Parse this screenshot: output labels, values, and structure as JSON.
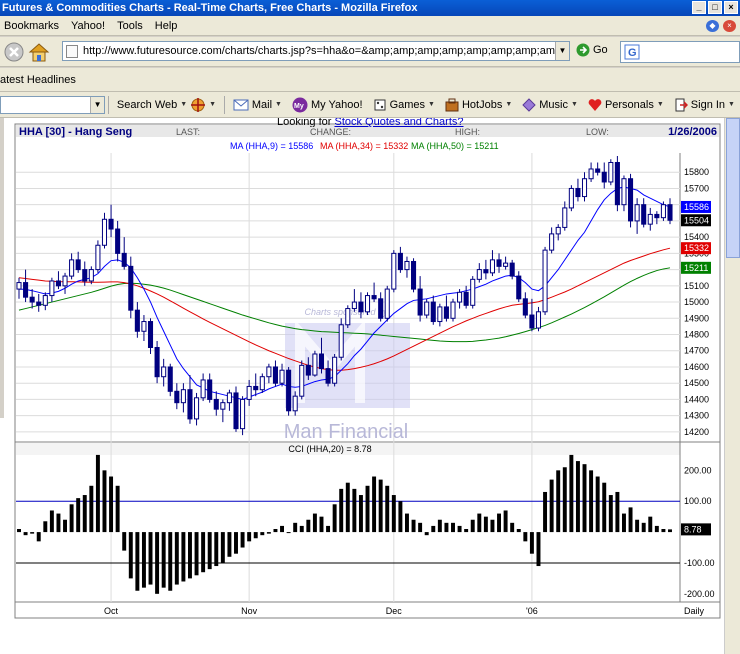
{
  "window": {
    "title": "Futures & Commodities Charts - Real-Time Charts, Free Charts - Mozilla Firefox"
  },
  "menu": {
    "items": [
      "Bookmarks",
      "Yahoo!",
      "Tools",
      "Help"
    ]
  },
  "nav": {
    "url": "http://www.futuresource.com/charts/charts.jsp?s=hha&o=&amp;amp;amp;amp;amp;amp;amp;amp;amp;a=D",
    "go_label": "Go"
  },
  "bookmarks": {
    "latest_headlines": "atest Headlines"
  },
  "yahoo_toolbar": {
    "search_web": "Search Web",
    "mail": "Mail",
    "my_yahoo": "My Yahoo!",
    "games": "Games",
    "hotjobs": "HotJobs",
    "music": "Music",
    "personals": "Personals",
    "sign_in": "Sign In"
  },
  "page": {
    "link_prefix": "Looking for ",
    "link_text": "Stock Quotes and Charts?"
  },
  "chart_header": {
    "symbol": "HHA [30] - Hang Seng",
    "last_label": "LAST:",
    "change_label": "CHANGE:",
    "high_label": "HIGH:",
    "low_label": "LOW:",
    "date": "1/26/2006"
  },
  "ma_legend": {
    "ma9": "MA (HHA,9) = 15586",
    "ma34": "MA (HHA,34) = 15332",
    "ma50": "MA (HHA,50) = 15211"
  },
  "watermark": {
    "sponsor": "Charts sponsored by",
    "brand": "Man Financial"
  },
  "cci_legend": "CCI (HHA,20) = 8.78",
  "colors": {
    "ma9": "#0000ff",
    "ma34": "#e00000",
    "ma50": "#008000",
    "candle": "#000080",
    "cci": "#000000"
  },
  "chart_data": {
    "type": "candlestick",
    "title": "HHA [30] - Hang Seng",
    "price_axis": {
      "ticks": [
        14200,
        14300,
        14400,
        14500,
        14600,
        14700,
        14800,
        14900,
        15000,
        15100,
        15200,
        15300,
        15400,
        15500,
        15600,
        15700,
        15800
      ],
      "ylim": [
        14150,
        15900
      ]
    },
    "price_badges": [
      {
        "label": "15586",
        "value": 15586,
        "bg": "#0000ff"
      },
      {
        "label": "15504",
        "value": 15504,
        "bg": "#000000"
      },
      {
        "label": "15332",
        "value": 15332,
        "bg": "#e00000"
      },
      {
        "label": "15211",
        "value": 15211,
        "bg": "#008000"
      }
    ],
    "x_labels": [
      {
        "label": "Oct",
        "index": 14
      },
      {
        "label": "Nov",
        "index": 35
      },
      {
        "label": "Dec",
        "index": 57
      },
      {
        "label": "'06",
        "index": 78
      },
      {
        "label": "Daily",
        "index": 97
      }
    ],
    "candles": [
      [
        15080,
        15150,
        15020,
        15120
      ],
      [
        15120,
        15200,
        15000,
        15030
      ],
      [
        15030,
        15080,
        14960,
        15000
      ],
      [
        15000,
        15050,
        14940,
        14980
      ],
      [
        14980,
        15060,
        14950,
        15040
      ],
      [
        15040,
        15150,
        15000,
        15130
      ],
      [
        15130,
        15190,
        15080,
        15100
      ],
      [
        15100,
        15180,
        15050,
        15160
      ],
      [
        15160,
        15300,
        15140,
        15260
      ],
      [
        15260,
        15310,
        15180,
        15200
      ],
      [
        15200,
        15250,
        15100,
        15130
      ],
      [
        15130,
        15220,
        15110,
        15200
      ],
      [
        15200,
        15380,
        15180,
        15350
      ],
      [
        15350,
        15550,
        15330,
        15510
      ],
      [
        15510,
        15600,
        15400,
        15450
      ],
      [
        15450,
        15500,
        15250,
        15300
      ],
      [
        15300,
        15400,
        15200,
        15220
      ],
      [
        15220,
        15280,
        14900,
        14950
      ],
      [
        14950,
        15000,
        14780,
        14820
      ],
      [
        14820,
        14920,
        14760,
        14880
      ],
      [
        14880,
        14900,
        14680,
        14720
      ],
      [
        14720,
        14760,
        14500,
        14540
      ],
      [
        14540,
        14650,
        14480,
        14600
      ],
      [
        14600,
        14620,
        14420,
        14450
      ],
      [
        14450,
        14500,
        14340,
        14380
      ],
      [
        14380,
        14500,
        14320,
        14460
      ],
      [
        14460,
        14550,
        14250,
        14280
      ],
      [
        14280,
        14440,
        14240,
        14410
      ],
      [
        14410,
        14560,
        14390,
        14520
      ],
      [
        14520,
        14560,
        14380,
        14400
      ],
      [
        14400,
        14450,
        14300,
        14340
      ],
      [
        14340,
        14400,
        14260,
        14380
      ],
      [
        14380,
        14460,
        14330,
        14440
      ],
      [
        14440,
        14480,
        14200,
        14220
      ],
      [
        14220,
        14420,
        14180,
        14400
      ],
      [
        14400,
        14520,
        14360,
        14480
      ],
      [
        14480,
        14560,
        14420,
        14460
      ],
      [
        14460,
        14560,
        14440,
        14540
      ],
      [
        14540,
        14620,
        14500,
        14600
      ],
      [
        14600,
        14640,
        14480,
        14500
      ],
      [
        14500,
        14620,
        14480,
        14580
      ],
      [
        14580,
        14600,
        14300,
        14330
      ],
      [
        14330,
        14450,
        14300,
        14420
      ],
      [
        14420,
        14640,
        14400,
        14610
      ],
      [
        14610,
        14660,
        14520,
        14550
      ],
      [
        14550,
        14700,
        14540,
        14680
      ],
      [
        14680,
        14780,
        14560,
        14590
      ],
      [
        14590,
        14640,
        14480,
        14500
      ],
      [
        14500,
        14680,
        14480,
        14660
      ],
      [
        14660,
        14900,
        14640,
        14860
      ],
      [
        14860,
        14980,
        14840,
        14960
      ],
      [
        14960,
        15080,
        14940,
        15000
      ],
      [
        15000,
        15060,
        14900,
        14940
      ],
      [
        14940,
        15060,
        14920,
        15040
      ],
      [
        15040,
        15120,
        15000,
        15020
      ],
      [
        15020,
        15060,
        14880,
        14900
      ],
      [
        14900,
        15100,
        14880,
        15080
      ],
      [
        15080,
        15320,
        15060,
        15300
      ],
      [
        15300,
        15340,
        15180,
        15200
      ],
      [
        15200,
        15280,
        15150,
        15250
      ],
      [
        15250,
        15270,
        15060,
        15080
      ],
      [
        15080,
        15160,
        14880,
        14920
      ],
      [
        14920,
        15020,
        14900,
        15000
      ],
      [
        15000,
        15040,
        14860,
        14880
      ],
      [
        14880,
        14990,
        14850,
        14970
      ],
      [
        14970,
        15040,
        14880,
        14900
      ],
      [
        14900,
        15020,
        14880,
        15000
      ],
      [
        15000,
        15080,
        14960,
        15060
      ],
      [
        15060,
        15100,
        14960,
        14980
      ],
      [
        14980,
        15160,
        14960,
        15140
      ],
      [
        15140,
        15240,
        15120,
        15200
      ],
      [
        15200,
        15260,
        15140,
        15180
      ],
      [
        15180,
        15320,
        15160,
        15260
      ],
      [
        15260,
        15300,
        15180,
        15220
      ],
      [
        15220,
        15280,
        15200,
        15240
      ],
      [
        15240,
        15260,
        15140,
        15160
      ],
      [
        15160,
        15190,
        15000,
        15020
      ],
      [
        15020,
        15060,
        14900,
        14920
      ],
      [
        14920,
        15020,
        14820,
        14840
      ],
      [
        14840,
        14970,
        14820,
        14940
      ],
      [
        14940,
        15340,
        14920,
        15320
      ],
      [
        15320,
        15460,
        15300,
        15420
      ],
      [
        15420,
        15480,
        15380,
        15460
      ],
      [
        15460,
        15620,
        15440,
        15580
      ],
      [
        15580,
        15720,
        15560,
        15700
      ],
      [
        15700,
        15760,
        15620,
        15650
      ],
      [
        15650,
        15800,
        15620,
        15760
      ],
      [
        15760,
        15860,
        15740,
        15820
      ],
      [
        15820,
        15860,
        15780,
        15800
      ],
      [
        15800,
        15860,
        15700,
        15740
      ],
      [
        15740,
        15880,
        15720,
        15860
      ],
      [
        15860,
        15900,
        15560,
        15600
      ],
      [
        15600,
        15780,
        15560,
        15760
      ],
      [
        15760,
        15790,
        15460,
        15500
      ],
      [
        15500,
        15640,
        15420,
        15600
      ],
      [
        15600,
        15640,
        15460,
        15480
      ],
      [
        15480,
        15580,
        15440,
        15540
      ],
      [
        15540,
        15560,
        15480,
        15520
      ],
      [
        15520,
        15620,
        15500,
        15600
      ],
      [
        15600,
        15640,
        15480,
        15504
      ]
    ],
    "ma9": [
      15080,
      15078,
      15070,
      15060,
      15050,
      15056,
      15066,
      15085,
      15110,
      15130,
      15140,
      15150,
      15175,
      15220,
      15255,
      15260,
      15245,
      15210,
      15150,
      15080,
      15000,
      14905,
      14820,
      14735,
      14650,
      14590,
      14540,
      14490,
      14470,
      14450,
      14440,
      14430,
      14420,
      14410,
      14400,
      14415,
      14430,
      14445,
      14465,
      14480,
      14495,
      14480,
      14475,
      14480,
      14495,
      14510,
      14520,
      14525,
      14540,
      14580,
      14620,
      14670,
      14710,
      14760,
      14810,
      14850,
      14890,
      14930,
      14960,
      14990,
      15010,
      15015,
      15020,
      15030,
      15040,
      15050,
      15055,
      15060,
      15070,
      15080,
      15095,
      15110,
      15130,
      15145,
      15160,
      15165,
      15150,
      15120,
      15080,
      15070,
      15100,
      15150,
      15200,
      15260,
      15320,
      15380,
      15430,
      15500,
      15570,
      15630,
      15670,
      15700,
      15710,
      15700,
      15690,
      15660,
      15640,
      15620,
      15600,
      15586
    ],
    "ma34": [
      15150,
      15145,
      15140,
      15135,
      15130,
      15128,
      15126,
      15125,
      15125,
      15124,
      15123,
      15122,
      15122,
      15123,
      15124,
      15124,
      15120,
      15112,
      15100,
      15085,
      15068,
      15050,
      15030,
      15008,
      14985,
      14962,
      14940,
      14918,
      14896,
      14875,
      14855,
      14835,
      14815,
      14795,
      14775,
      14755,
      14736,
      14718,
      14700,
      14684,
      14668,
      14652,
      14638,
      14624,
      14610,
      14600,
      14590,
      14584,
      14580,
      14580,
      14584,
      14590,
      14598,
      14608,
      14620,
      14634,
      14650,
      14668,
      14688,
      14708,
      14728,
      14748,
      14768,
      14788,
      14808,
      14828,
      14848,
      14866,
      14884,
      14900,
      14916,
      14930,
      14944,
      14958,
      14970,
      14980,
      14986,
      14990,
      14995,
      15002,
      15015,
      15030,
      15046,
      15062,
      15080,
      15100,
      15120,
      15140,
      15160,
      15180,
      15200,
      15220,
      15240,
      15256,
      15270,
      15284,
      15298,
      15310,
      15322,
      15332
    ],
    "ma50": [
      14950,
      14960,
      14970,
      14980,
      14990,
      15000,
      15010,
      15020,
      15030,
      15040,
      15050,
      15060,
      15072,
      15085,
      15098,
      15108,
      15114,
      15116,
      15114,
      15110,
      15104,
      15096,
      15086,
      15074,
      15060,
      15046,
      15032,
      15018,
      15004,
      14990,
      14976,
      14962,
      14948,
      14934,
      14920,
      14908,
      14896,
      14884,
      14872,
      14862,
      14852,
      14844,
      14836,
      14830,
      14826,
      14822,
      14818,
      14816,
      14814,
      14812,
      14810,
      14808,
      14806,
      14804,
      14800,
      14796,
      14792,
      14788,
      14784,
      14780,
      14776,
      14772,
      14768,
      14764,
      14760,
      14758,
      14756,
      14756,
      14756,
      14758,
      14762,
      14766,
      14772,
      14778,
      14786,
      14796,
      14806,
      14818,
      14830,
      14842,
      14856,
      14872,
      14890,
      14908,
      14926,
      14946,
      14966,
      14988,
      15010,
      15032,
      15056,
      15080,
      15104,
      15126,
      15146,
      15164,
      15180,
      15194,
      15204,
      15211
    ],
    "cci": {
      "ticks": [
        -200,
        -100,
        0,
        100,
        200
      ],
      "ylim": [
        -220,
        240
      ],
      "value_label": "8.78",
      "values": [
        10,
        -10,
        -5,
        -30,
        35,
        70,
        60,
        40,
        90,
        110,
        120,
        150,
        250,
        200,
        180,
        150,
        -60,
        -150,
        -190,
        -180,
        -170,
        -200,
        -180,
        -190,
        -170,
        -160,
        -150,
        -140,
        -130,
        -120,
        -110,
        -100,
        -80,
        -70,
        -50,
        -30,
        -20,
        -10,
        -5,
        10,
        20,
        0,
        30,
        20,
        40,
        60,
        50,
        20,
        90,
        140,
        160,
        140,
        120,
        150,
        180,
        170,
        150,
        120,
        100,
        60,
        40,
        30,
        -10,
        20,
        40,
        30,
        30,
        20,
        10,
        40,
        60,
        50,
        40,
        60,
        70,
        30,
        10,
        -30,
        -70,
        -110,
        130,
        170,
        200,
        210,
        250,
        230,
        220,
        200,
        180,
        160,
        120,
        130,
        60,
        80,
        40,
        30,
        50,
        20,
        10,
        8.78
      ]
    }
  }
}
